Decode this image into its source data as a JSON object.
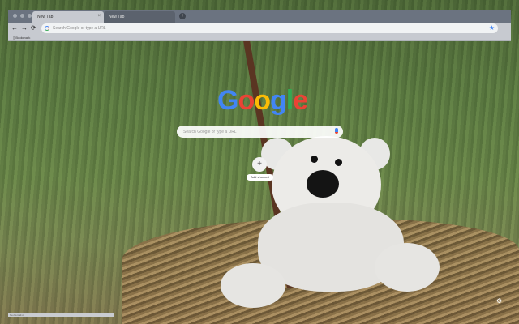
{
  "browser": {
    "tabs": [
      {
        "label": "New Tab",
        "active": true
      },
      {
        "label": "New Tab",
        "active": false
      }
    ],
    "tab_close": "×",
    "new_tab": "+",
    "nav": {
      "back": "←",
      "forward": "→",
      "reload": "⟳"
    },
    "omnibox_placeholder": "Search Google or type a URL",
    "bookmark_star": "★",
    "menu": "⋮",
    "bookmarks": [
      {
        "label": "Bookmark"
      }
    ],
    "status_text": "file:///email.xs"
  },
  "ntp": {
    "logo": [
      "G",
      "o",
      "o",
      "g",
      "l",
      "e"
    ],
    "logo_colors": [
      "#4285f4",
      "#ea4335",
      "#fbbc05",
      "#4285f4",
      "#34a853",
      "#ea4335"
    ],
    "search_placeholder": "Search Google or type a URL",
    "add_shortcut_icon": "+",
    "add_shortcut_label": "Add shortcut",
    "customize_icon": "⚙"
  }
}
